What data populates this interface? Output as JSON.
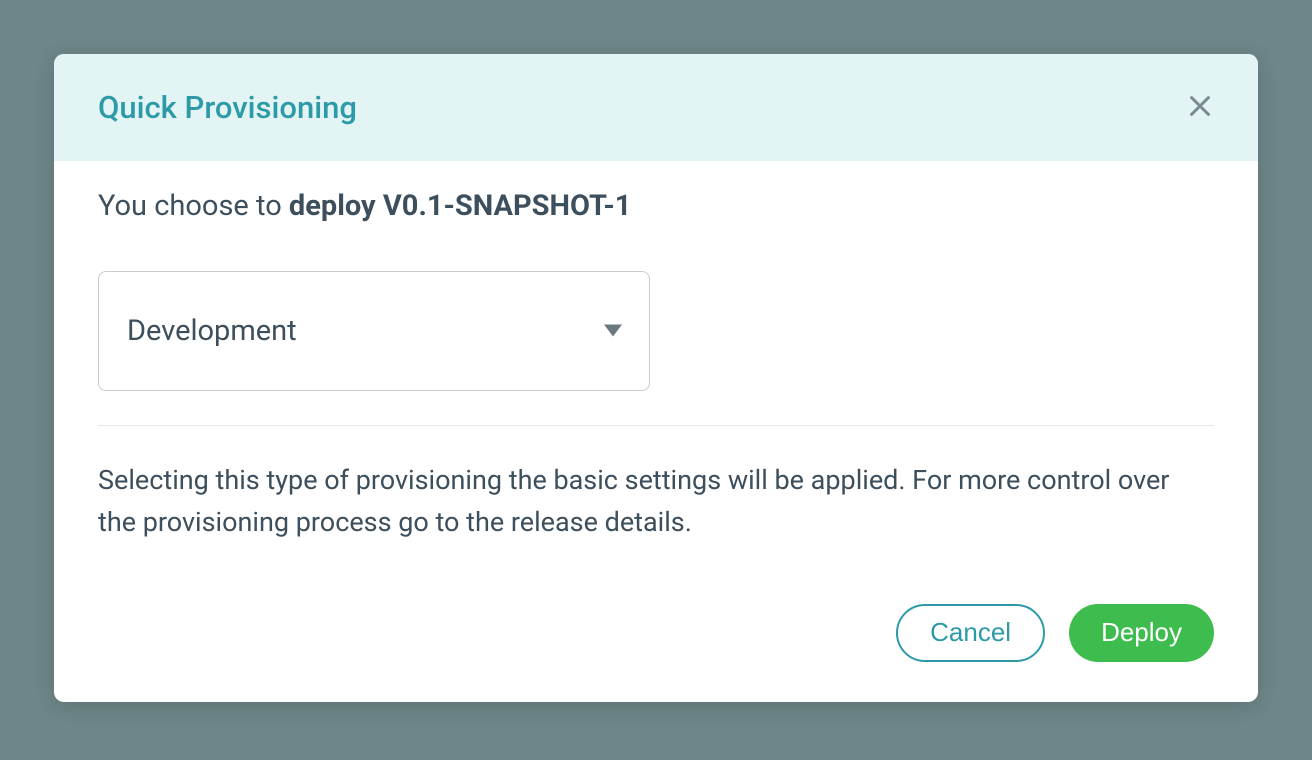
{
  "modal": {
    "title": "Quick Provisioning",
    "subtitle_prefix": "You choose to ",
    "subtitle_bold": "deploy V0.1-SNAPSHOT-1",
    "select": {
      "selected": "Development"
    },
    "description": "Selecting this type of provisioning the basic settings will be applied. For more control over the provisioning process go to the release details.",
    "actions": {
      "cancel": "Cancel",
      "deploy": "Deploy"
    }
  }
}
